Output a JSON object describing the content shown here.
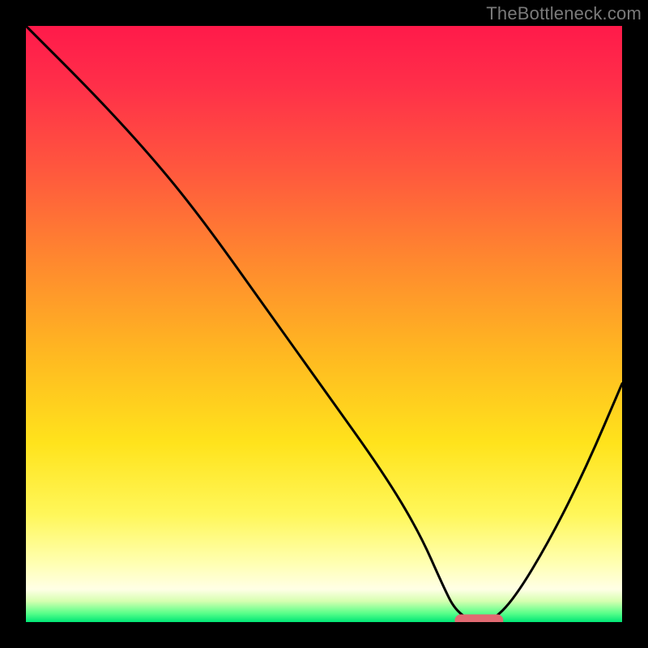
{
  "watermark": "TheBottleneck.com",
  "colors": {
    "curve": "#000000",
    "marker_fill": "#e16a72",
    "marker_stroke": "#e16a72",
    "gradient_stops": [
      {
        "offset": 0.0,
        "color": "#ff1a4a"
      },
      {
        "offset": 0.1,
        "color": "#ff2f49"
      },
      {
        "offset": 0.25,
        "color": "#ff5a3d"
      },
      {
        "offset": 0.4,
        "color": "#ff8a2e"
      },
      {
        "offset": 0.55,
        "color": "#ffb821"
      },
      {
        "offset": 0.7,
        "color": "#ffe31c"
      },
      {
        "offset": 0.82,
        "color": "#fff75a"
      },
      {
        "offset": 0.9,
        "color": "#ffffb0"
      },
      {
        "offset": 0.945,
        "color": "#ffffe6"
      },
      {
        "offset": 0.965,
        "color": "#d6ffb0"
      },
      {
        "offset": 0.985,
        "color": "#5aff8a"
      },
      {
        "offset": 1.0,
        "color": "#00e676"
      }
    ]
  },
  "chart_data": {
    "type": "line",
    "title": "",
    "xlabel": "",
    "ylabel": "",
    "xlim": [
      0,
      100
    ],
    "ylim": [
      0,
      100
    ],
    "grid": false,
    "x": [
      0,
      12,
      22,
      30,
      40,
      50,
      60,
      66,
      70,
      72,
      75,
      78,
      82,
      88,
      94,
      100
    ],
    "values": [
      100,
      88,
      77,
      67,
      53,
      39,
      25,
      15,
      6,
      2,
      0,
      0,
      4,
      14,
      26,
      40
    ],
    "optimum_marker": {
      "x_start": 72,
      "x_end": 80,
      "y": 0
    }
  }
}
